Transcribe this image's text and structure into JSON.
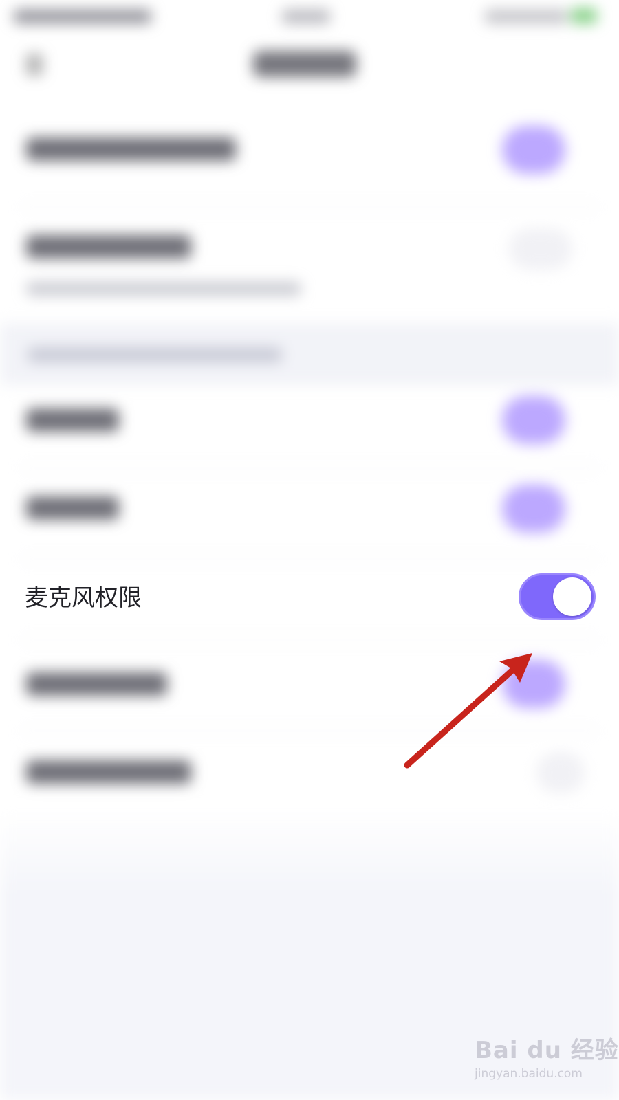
{
  "settings": {
    "microphone_permission": {
      "label": "麦克风权限",
      "enabled": true
    }
  },
  "colors": {
    "toggle_on": "#7f68fb",
    "toggle_knob": "#ffffff",
    "annotation_arrow": "#c8241c",
    "background": "#ffffff"
  },
  "watermark": {
    "brand": "Bai du 经验",
    "url": "jingyan.baidu.com"
  }
}
